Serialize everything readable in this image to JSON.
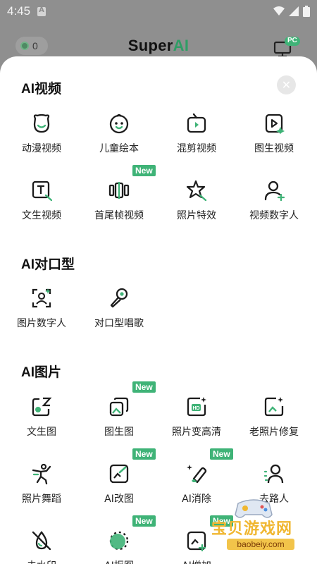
{
  "status_bar": {
    "time": "4:45"
  },
  "app_bar": {
    "coins": "0",
    "brand_main": "Super",
    "brand_accent": "AI",
    "pc_badge": "PC"
  },
  "colors": {
    "accent": "#3fb377",
    "overlay": "#8f8f8f",
    "sheet": "#ffffff"
  },
  "sections": [
    {
      "title": "AI视频",
      "items": [
        {
          "label": "动漫视频",
          "icon": "bear-face-icon"
        },
        {
          "label": "儿童绘本",
          "icon": "baby-face-icon"
        },
        {
          "label": "混剪视频",
          "icon": "tv-clip-icon"
        },
        {
          "label": "图生视频",
          "icon": "image-video-icon"
        },
        {
          "label": "文生视频",
          "icon": "text-video-icon"
        },
        {
          "label": "首尾帧视频",
          "icon": "keyframe-icon",
          "badge": "New"
        },
        {
          "label": "照片特效",
          "icon": "star-effect-icon"
        },
        {
          "label": "视频数字人",
          "icon": "digital-human-icon"
        }
      ]
    },
    {
      "title": "AI对口型",
      "items": [
        {
          "label": "图片数字人",
          "icon": "face-scan-icon"
        },
        {
          "label": "对口型唱歌",
          "icon": "microphone-icon"
        }
      ]
    },
    {
      "title": "AI图片",
      "items": [
        {
          "label": "文生图",
          "icon": "text-to-image-icon"
        },
        {
          "label": "图生图",
          "icon": "image-to-image-icon",
          "badge": "New"
        },
        {
          "label": "照片变高清",
          "icon": "hd-photo-icon"
        },
        {
          "label": "老照片修复",
          "icon": "photo-repair-icon"
        },
        {
          "label": "照片舞蹈",
          "icon": "dance-icon"
        },
        {
          "label": "AI改图",
          "icon": "edit-image-icon",
          "badge": "New"
        },
        {
          "label": "AI消除",
          "icon": "eraser-icon",
          "badge": "New"
        },
        {
          "label": "去路人",
          "icon": "remove-person-icon"
        },
        {
          "label": "去水印",
          "icon": "remove-watermark-icon"
        },
        {
          "label": "AI抠图",
          "icon": "cutout-icon",
          "badge": "New"
        },
        {
          "label": "AI增加",
          "icon": "add-image-icon",
          "badge": "New"
        }
      ]
    }
  ],
  "watermark": {
    "text": "宝贝游戏网",
    "url": "baobeiy.com"
  }
}
